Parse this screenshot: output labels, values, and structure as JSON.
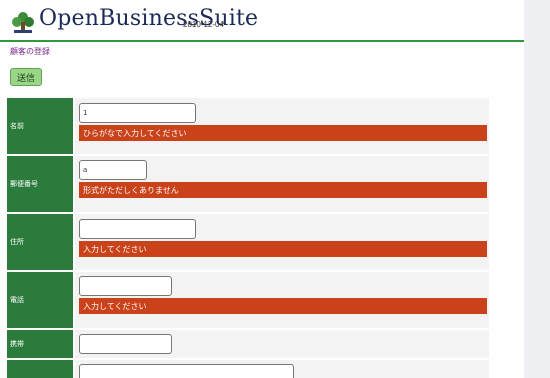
{
  "header": {
    "logo_text": "OpenBusinessSuite",
    "date": "2010-12-04"
  },
  "page": {
    "title": "顧客の登録",
    "submit_label": "送信"
  },
  "form": {
    "rows": [
      {
        "label": "名前",
        "value": "1",
        "error": "ひらがなで入力してください"
      },
      {
        "label": "郵便番号",
        "value": "a",
        "error": "形式がただしくありません"
      },
      {
        "label": "住所",
        "value": "",
        "error": "入力してください"
      },
      {
        "label": "電話",
        "value": "",
        "error": "入力してください"
      },
      {
        "label": "携帯",
        "value": ""
      },
      {
        "label": "",
        "value": ""
      }
    ]
  },
  "colors": {
    "label_bg": "#2b7b3c",
    "error_bg": "#c9421a",
    "accent_green": "#2e9a3c",
    "title_purple": "#7b2a8a"
  }
}
